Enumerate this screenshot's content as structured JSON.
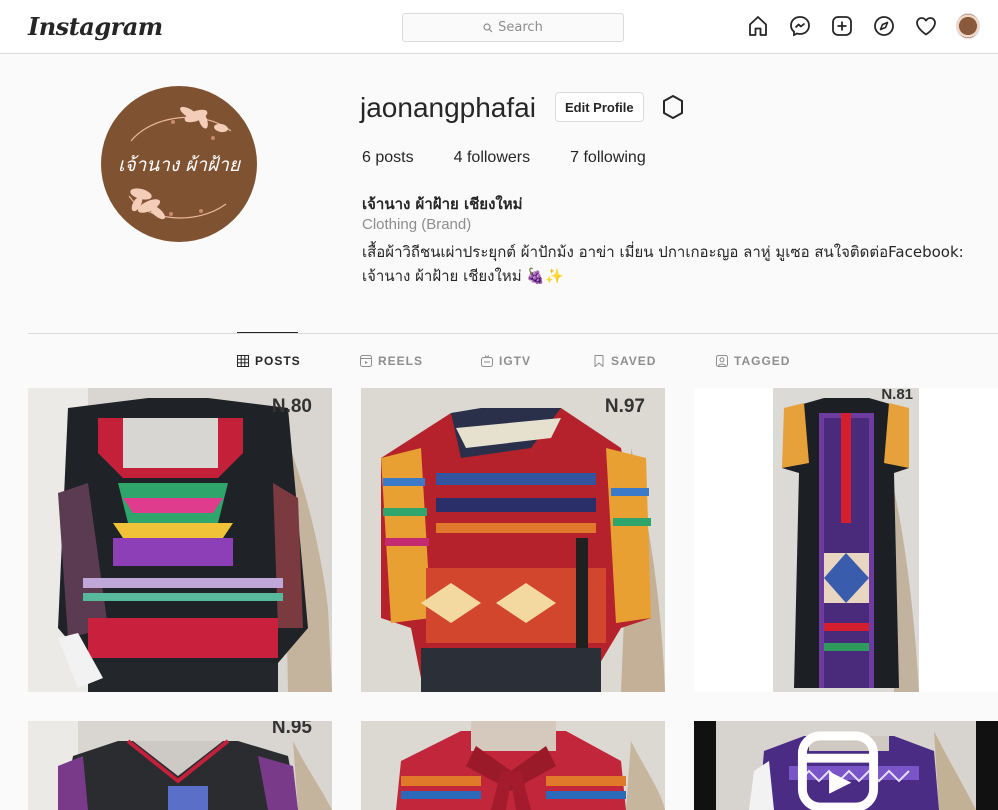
{
  "nav": {
    "logo": "Instagram",
    "search_placeholder": "Search"
  },
  "profile": {
    "avatar_text": "เจ้านาง ผ้าฝ้าย",
    "username": "jaonangphafai",
    "edit_label": "Edit Profile",
    "stats": {
      "posts_num": "6",
      "posts_label": "posts",
      "followers_num": "4",
      "followers_label": "followers",
      "following_num": "7",
      "following_label": "following"
    },
    "full_name": "เจ้านาง ผ้าฝ้าย เชียงใหม่",
    "category": "Clothing (Brand)",
    "bio_line1": "เสื้อผ้าวิถีชนเผ่าประยุกต์ ผ้าปักม้ง อาข่า เมี่ยน ปกาเกอะญอ ลาหู่ มูเซอ สนใจติดต่อFacebook:",
    "bio_line2": "เจ้านาง ผ้าฝ้าย เชียงใหม่ 🍇✨"
  },
  "tabs": [
    {
      "label": "POSTS",
      "icon": "grid-icon"
    },
    {
      "label": "REELS",
      "icon": "reels-icon"
    },
    {
      "label": "IGTV",
      "icon": "igtv-icon"
    },
    {
      "label": "SAVED",
      "icon": "bookmark-icon"
    },
    {
      "label": "TAGGED",
      "icon": "tag-icon"
    }
  ],
  "posts": [
    {
      "code": "N.80"
    },
    {
      "code": "N.97"
    },
    {
      "code": "N.81"
    },
    {
      "code": "N.95"
    },
    {
      "code": ""
    },
    {
      "code": ""
    }
  ],
  "colors": {
    "border": "#dbdbdb",
    "text": "#262626",
    "muted": "#8e8e8e",
    "avatar_bg": "#7f5232"
  }
}
